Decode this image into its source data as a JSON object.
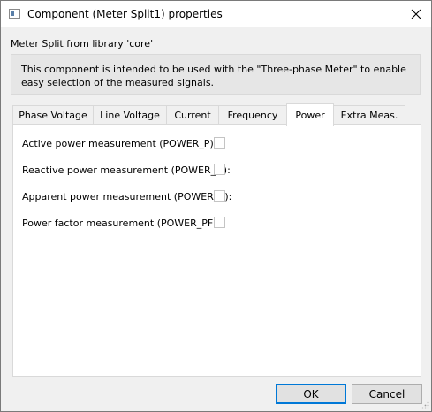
{
  "window": {
    "title": "Component (Meter Split1) properties"
  },
  "library_text": "Meter Split from library 'core'",
  "description": "This component is intended to be used with the \"Three-phase Meter\" to enable easy selection of the measured signals.",
  "tabs": [
    {
      "label": "Phase Voltage",
      "active": false
    },
    {
      "label": "Line Voltage",
      "active": false
    },
    {
      "label": "Current",
      "active": false
    },
    {
      "label": "Frequency",
      "active": false
    },
    {
      "label": "Power",
      "active": true
    },
    {
      "label": "Extra Meas.",
      "active": false
    }
  ],
  "power_fields": [
    {
      "label": "Active power measurement (POWER_P):",
      "checked": false
    },
    {
      "label": "Reactive power measurement (POWER_Q):",
      "checked": false
    },
    {
      "label": "Apparent power measurement (POWER_S):",
      "checked": false
    },
    {
      "label": "Power factor measurement (POWER_PF):",
      "checked": false
    }
  ],
  "buttons": {
    "ok": "OK",
    "cancel": "Cancel"
  }
}
